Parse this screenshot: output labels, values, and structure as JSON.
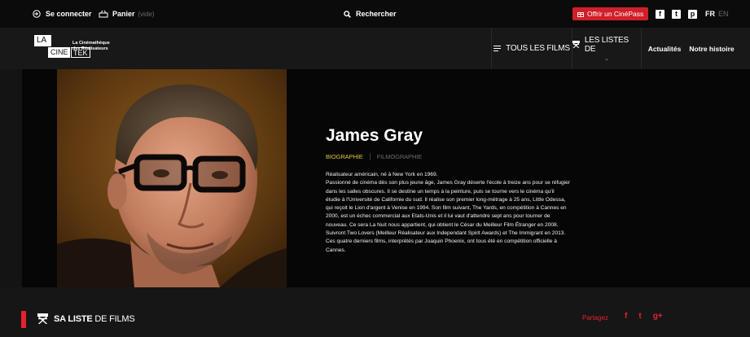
{
  "topbar": {
    "login_label": "Se connecter",
    "cart_label": "Panier",
    "cart_status": "(vide)",
    "search_label": "Rechercher",
    "pass_label": "Offrir un CinéPass",
    "socials": [
      "f",
      "t",
      "p"
    ],
    "lang_active": "FR",
    "lang_other": "EN"
  },
  "header": {
    "logo_la": "LA",
    "logo_cine": "CINE",
    "logo_tek": "TEK",
    "tagline_1": "La Cinémathèque",
    "tagline_2": "des Réalisateurs",
    "nav_films": "TOUS LES FILMS",
    "nav_lists": "LES LISTES DE",
    "nav_news": "Actualités",
    "nav_story": "Notre histoire"
  },
  "profile": {
    "name": "James Gray",
    "tab_bio": "BIOGRAPHIE",
    "tab_filmo": "FILMOGRAPHIE",
    "bio_lines": [
      "Réalisateur américain, né à New York en 1969.",
      "Passionné de cinéma dès son plus jeune âge, James Gray déserte l'école à treize ans pour se réfugier",
      "dans les salles obscures. Il se destine un temps à la peinture, puis se tourne vers le cinéma qu'il",
      "étudie à l'Université de Californie du sud. Il réalise son premier long-métrage à 25 ans, Little Odessa,",
      "qui reçoit le Lion d'argent à Venise en 1994. Son film suivant, The Yards, en compétition à Cannes en",
      "2000, est un échec commercial aux Etats-Unis et il lui vaut d'attendre sept ans pour tourner de",
      "nouveau. Ce sera La Nuit nous appartient, qui obtient le César du Meilleur Film Étranger en 2008.",
      "Suivront Two Lovers (Meilleur Réalisateur aux Independant Spirit Awards) et The Immigrant en 2013.",
      "Ces quatre derniers films, interprétés par Joaquin Phoenix, ont tous été en compétition officielle à",
      "Cannes."
    ]
  },
  "list_section": {
    "title_bold": "SA LISTE",
    "title_rest": " DE FILMS",
    "share_label": "Partagez",
    "share_icons": [
      "f",
      "t",
      "g+"
    ]
  },
  "colors": {
    "accent_red": "#e5222d",
    "tab_active": "#e0c53a"
  }
}
